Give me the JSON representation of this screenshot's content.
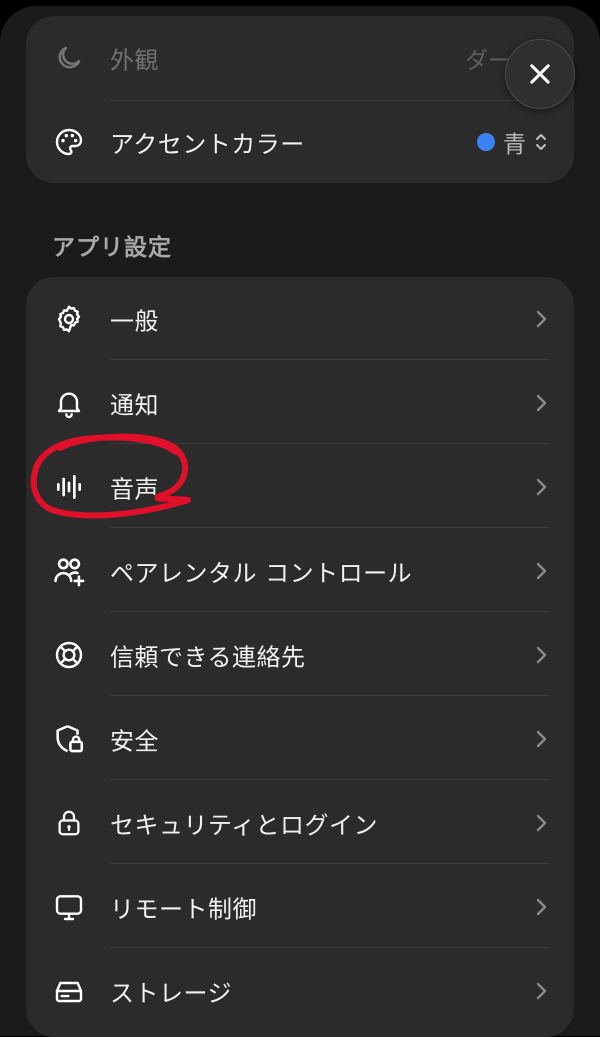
{
  "appearance": {
    "label": "外観",
    "value": "ダーク"
  },
  "accent": {
    "label": "アクセントカラー",
    "value": "青",
    "color": "#3b82f6"
  },
  "section": {
    "title": "アプリ設定"
  },
  "items": [
    {
      "label": "一般",
      "icon": "gear-icon"
    },
    {
      "label": "通知",
      "icon": "bell-icon"
    },
    {
      "label": "音声",
      "icon": "waveform-icon"
    },
    {
      "label": "ペアレンタル コントロール",
      "icon": "people-add-icon"
    },
    {
      "label": "信頼できる連絡先",
      "icon": "lifebuoy-icon"
    },
    {
      "label": "安全",
      "icon": "shield-lock-icon"
    },
    {
      "label": "セキュリティとログイン",
      "icon": "lock-icon"
    },
    {
      "label": "リモート制御",
      "icon": "monitor-icon"
    },
    {
      "label": "ストレージ",
      "icon": "drive-icon"
    }
  ],
  "annotation": {
    "color": "#e0102a",
    "target": "音声"
  }
}
